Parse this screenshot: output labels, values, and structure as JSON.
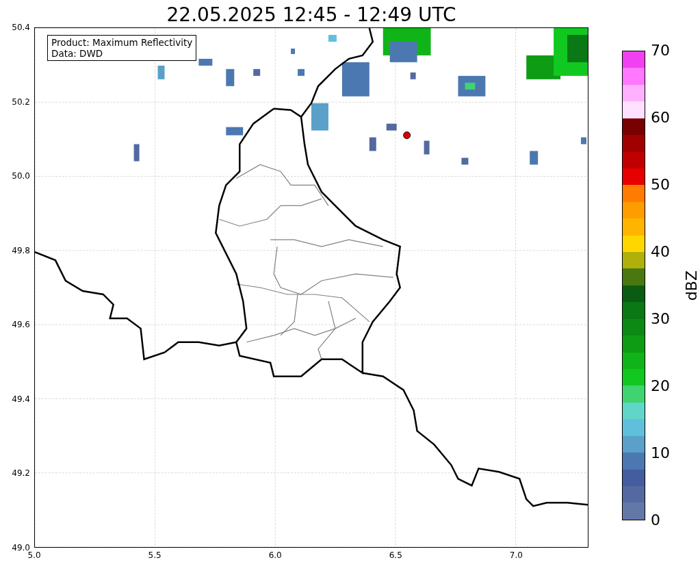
{
  "title": "22.05.2025 12:45 - 12:49 UTC",
  "info_box": {
    "lines": [
      "Product: Maximum Reflectivity",
      "Data: DWD"
    ]
  },
  "x_ticks": [
    "5.0",
    "5.5",
    "6.0",
    "6.5",
    "7.0"
  ],
  "y_ticks": [
    "50.4",
    "50.2",
    "50.0",
    "49.8",
    "49.6",
    "49.4",
    "49.2",
    "49.0"
  ],
  "colorbar": {
    "label": "dBZ",
    "ticks": [
      "70",
      "60",
      "50",
      "40",
      "30",
      "20",
      "10",
      "0"
    ],
    "segments": [
      {
        "color": "#6478a8"
      },
      {
        "color": "#53699f"
      },
      {
        "color": "#435d9e"
      },
      {
        "color": "#4b78b0"
      },
      {
        "color": "#5aa0c8"
      },
      {
        "color": "#60c0dc"
      },
      {
        "color": "#60d6c8"
      },
      {
        "color": "#40d470"
      },
      {
        "color": "#10c820"
      },
      {
        "color": "#10b418"
      },
      {
        "color": "#0e9c14"
      },
      {
        "color": "#0c8814"
      },
      {
        "color": "#0a7814"
      },
      {
        "color": "#0a5c12"
      },
      {
        "color": "#4a7810"
      },
      {
        "color": "#b0b00a"
      },
      {
        "color": "#ffd700"
      },
      {
        "color": "#ffb400"
      },
      {
        "color": "#ff9c00"
      },
      {
        "color": "#ff7c00"
      },
      {
        "color": "#e60000"
      },
      {
        "color": "#c00000"
      },
      {
        "color": "#a00000"
      },
      {
        "color": "#780000"
      },
      {
        "color": "#ffe0ff"
      },
      {
        "color": "#ffb0ff"
      },
      {
        "color": "#ff78ff"
      },
      {
        "color": "#f040f0"
      }
    ]
  }
}
